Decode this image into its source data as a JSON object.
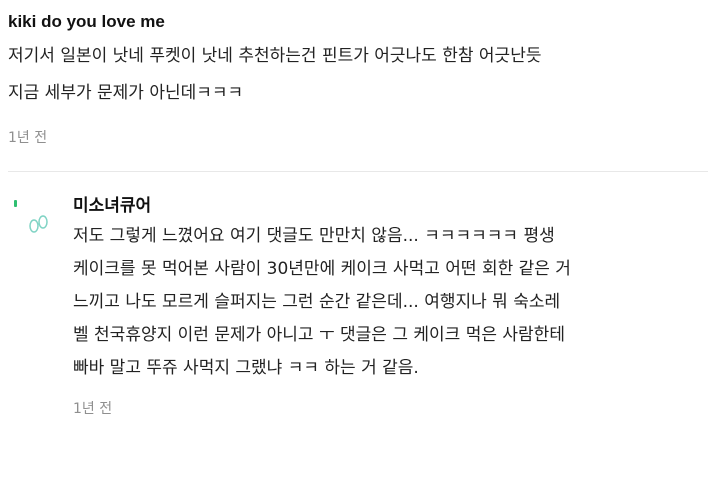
{
  "top_comment": {
    "author": "kiki do you love me",
    "text": "저기서 일본이 낫네 푸켓이 낫네 추천하는건 핀트가 어긋나도 한참 어긋난듯\n지금 세부가 문제가 아닌데ㅋㅋㅋ",
    "time": "1년 전"
  },
  "reply": {
    "avatar_icon": "profile-avatar-icon",
    "author": "미소녀큐어",
    "text": "저도 그렇게 느꼈어요 여기 댓글도 만만치 않음... ㅋㅋㅋㅋㅋㅋ 평생\n케이크를 못 먹어본 사람이 30년만에 케이크 사먹고 어떤 회한 같은 거\n느끼고 나도 모르게 슬퍼지는 그런 순간 같은데... 여행지나 뭐 숙소레\n벨 천국휴양지 이런 문제가 아니고 ㅜ 댓글은 그 케이크 먹은 사람한테\n빠바 말고 뚜쥬 사먹지 그랬냐 ㅋㅋ 하는 거 같음.",
    "time": "1년 전"
  },
  "colors": {
    "avatar_green": "#2fbf71",
    "avatar_teal": "#7fd3c4",
    "time_gray": "#8f8f8f"
  }
}
